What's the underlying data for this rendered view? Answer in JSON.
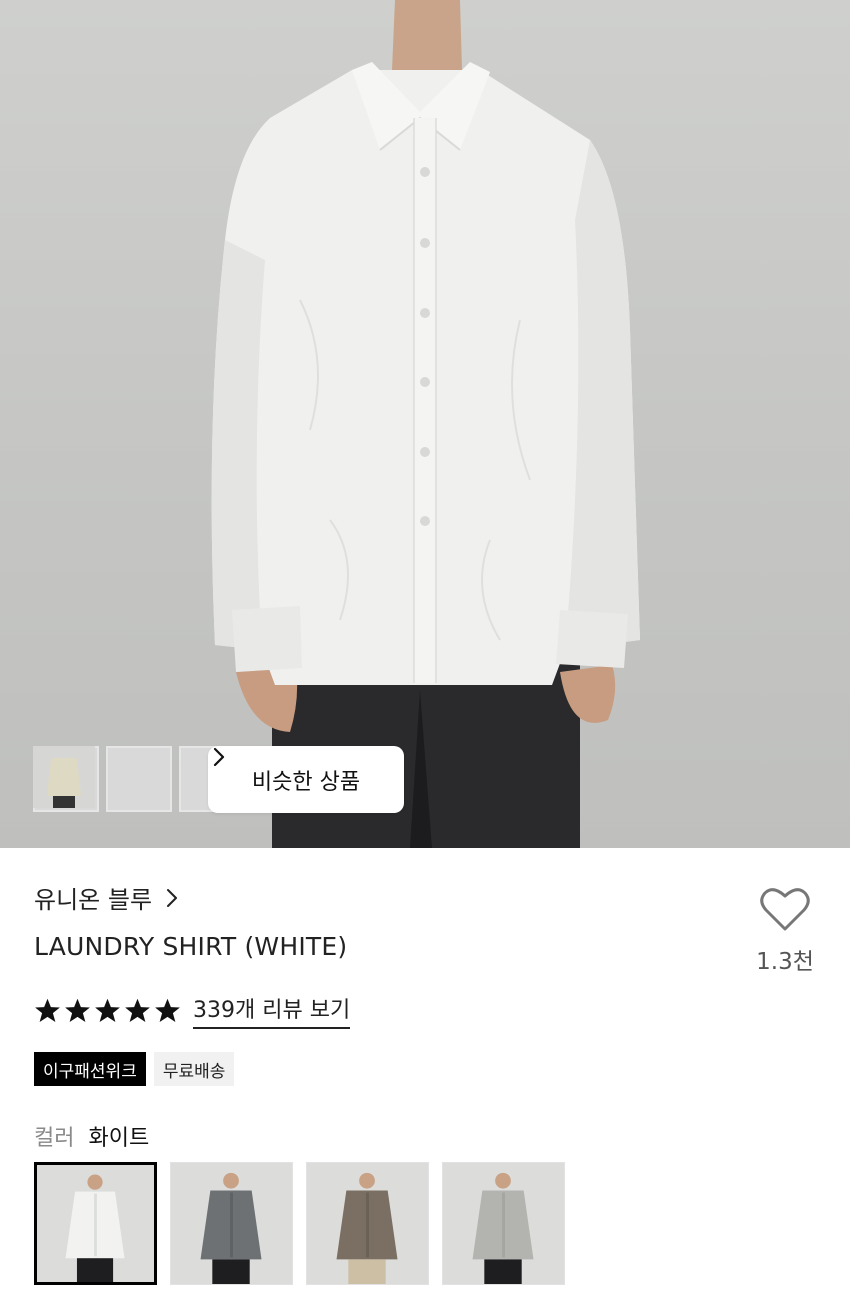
{
  "gallery": {
    "thumbnails": [
      "blue-shirt",
      "grey-shirt",
      "beige-shirt"
    ],
    "similar_button_label": "비슷한 상품"
  },
  "product": {
    "brand": "유니온 블루",
    "name": "LAUNDRY SHIRT (WHITE)",
    "like_count": "1.3천",
    "rating_stars": 5,
    "review_link": "339개 리뷰 보기"
  },
  "badges": {
    "event": "이구패션위크",
    "shipping": "무료배송"
  },
  "color": {
    "label": "컬러",
    "selected": "화이트",
    "options": [
      "white",
      "charcoal",
      "brown",
      "light-grey"
    ]
  },
  "colors": {
    "star": "#111111",
    "badge_dark": "#000000",
    "background": "#ffffff"
  }
}
